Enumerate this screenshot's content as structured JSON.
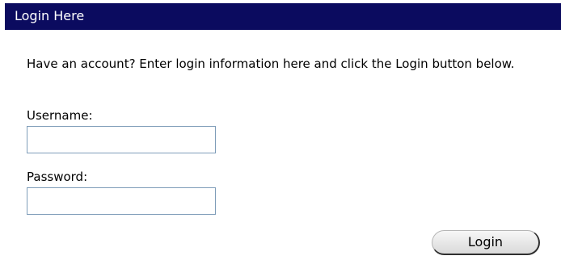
{
  "header": {
    "title": "Login Here"
  },
  "intro": {
    "text": "Have an account? Enter login information here and click the Login button below."
  },
  "form": {
    "username_label": "Username:",
    "username_value": "",
    "password_label": "Password:",
    "password_value": "",
    "login_label": "Login"
  },
  "colors": {
    "header_background": "#0b0b5f",
    "header_text": "#ffffff",
    "input_border": "#7f9db9",
    "button_face": "#e6e6e6",
    "button_shadow": "#2f2f2f"
  }
}
